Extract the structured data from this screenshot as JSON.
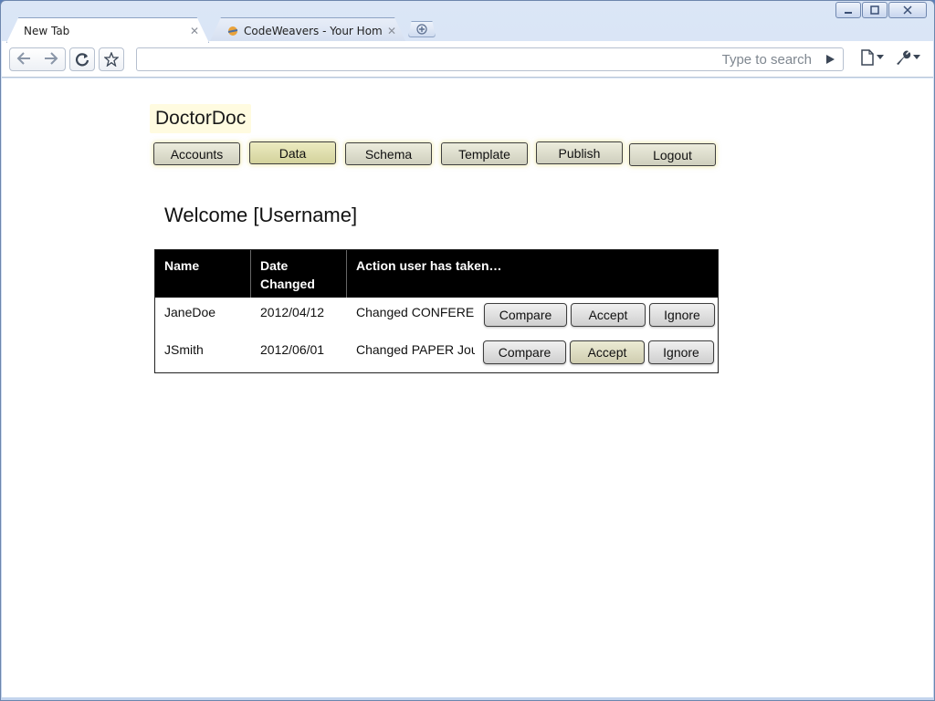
{
  "browser": {
    "tabs": [
      {
        "title": "New Tab",
        "active": true
      },
      {
        "title": "CodeWeavers - Your Home…",
        "active": false
      }
    ],
    "search_placeholder": "Type to search"
  },
  "app": {
    "title": "DoctorDoc",
    "menu": [
      {
        "label": "Accounts"
      },
      {
        "label": "Data"
      },
      {
        "label": "Schema"
      },
      {
        "label": "Template"
      },
      {
        "label": "Publish"
      },
      {
        "label": "Logout"
      }
    ],
    "welcome": "Welcome [Username]",
    "table": {
      "headers": [
        "Name",
        "Date Changed",
        "Action user has taken…"
      ],
      "rows": [
        {
          "name": "JaneDoe",
          "date": "2012/04/12",
          "action": "Changed CONFERENCE"
        },
        {
          "name": "JSmith",
          "date": "2012/06/01",
          "action": "Changed PAPER Journal"
        }
      ],
      "buttons": {
        "compare": "Compare",
        "accept": "Accept",
        "ignore": "Ignore"
      }
    }
  },
  "colors": {
    "title_bg": "#fffbe0",
    "active_menu": "#d3d29c",
    "table_header_bg": "#000000"
  }
}
